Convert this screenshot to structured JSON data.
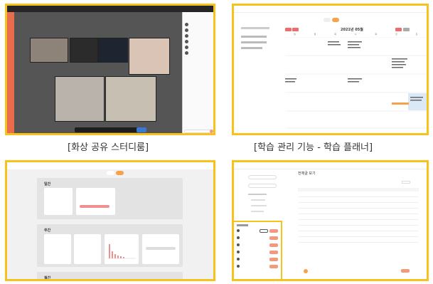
{
  "captions": {
    "video_room": "[화상 공유 스터디룸]",
    "planner": "[학습 관리 기능 - 학습 플래너]"
  },
  "planner_calendar": {
    "month_label": "2021년 05월",
    "weekdays": [
      "일",
      "월",
      "화",
      "수",
      "목",
      "금",
      "토"
    ]
  },
  "dashboard": {
    "sections": [
      "일간",
      "주간",
      "월간"
    ]
  },
  "group_table": {
    "title": "전체글 보기"
  },
  "colors": {
    "frame": "#f7c21b",
    "accent": "#f29a7c",
    "sidebar": "#e96d4d",
    "record_button": "#3a78d8"
  }
}
